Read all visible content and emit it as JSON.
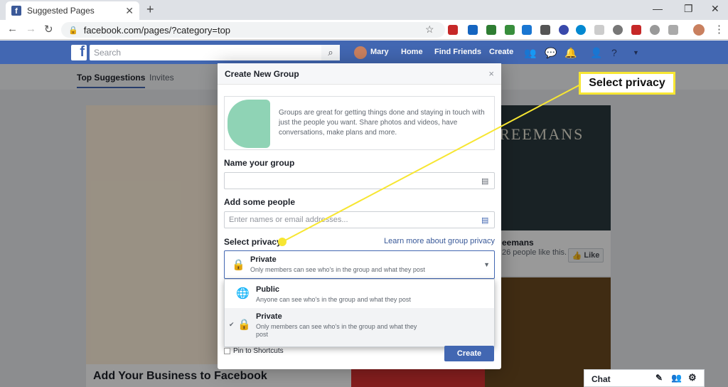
{
  "browser": {
    "tab_title": "Suggested Pages",
    "tab_close": "✕",
    "new_tab": "+",
    "url": "facebook.com/pages/?category=top"
  },
  "fb_header": {
    "logo": "f",
    "search_placeholder": "Search",
    "user_name": "Mary",
    "home": "Home",
    "find_friends": "Find Friends",
    "create": "Create"
  },
  "subtabs": {
    "top_suggestions": "Top Suggestions",
    "invites": "Invites"
  },
  "background_cards": {
    "card1_title": "Add Your Business to Facebook",
    "card2_banner": "FREEMANS",
    "card2_name": "eemans",
    "card2_likes": "26 people like this.",
    "like_label": "Like"
  },
  "chat": {
    "label": "Chat"
  },
  "modal": {
    "title": "Create New Group",
    "close": "×",
    "intro": "Groups are great for getting things done and staying in touch with just the people you want. Share photos and videos, have conversations, make plans and more.",
    "name_label": "Name your group",
    "name_value": "",
    "people_label": "Add some people",
    "people_placeholder": "Enter names or email addresses...",
    "privacy_label": "Select privacy",
    "learn_more": "Learn more about group privacy",
    "selected": {
      "title": "Private",
      "desc": "Only members can see who's in the group and what they post"
    },
    "options": [
      {
        "title": "Public",
        "desc": "Anyone can see who's in the group and what they post",
        "icon": "globe-icon",
        "checked": false
      },
      {
        "title": "Private",
        "desc": "Only members can see who's in the group and what they post",
        "icon": "lock-icon",
        "checked": true
      }
    ],
    "pin_label": "Pin to Shortcuts",
    "create_button": "Create"
  },
  "callout": {
    "text": "Select privacy",
    "color": "#f7e632"
  },
  "colors": {
    "fb_blue": "#4267b2",
    "link": "#385898"
  }
}
